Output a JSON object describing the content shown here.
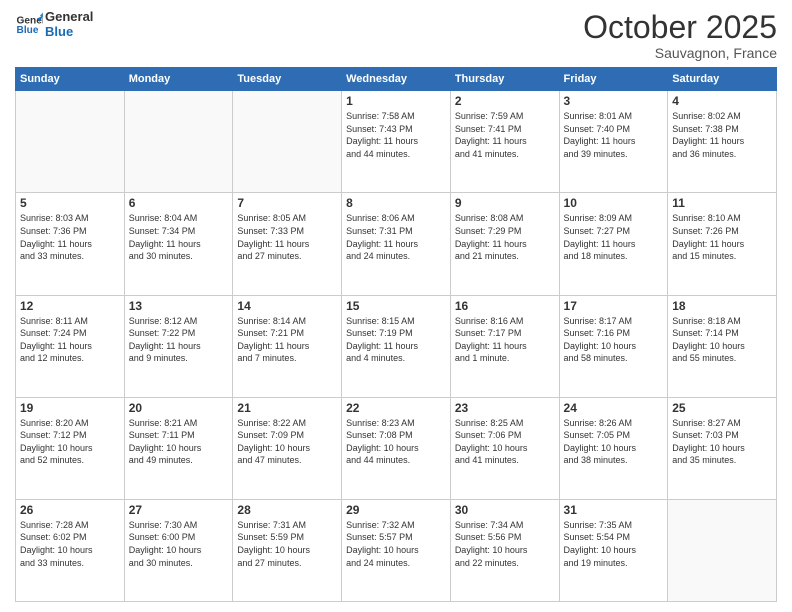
{
  "header": {
    "logo_line1": "General",
    "logo_line2": "Blue",
    "month": "October 2025",
    "location": "Sauvagnon, France"
  },
  "weekdays": [
    "Sunday",
    "Monday",
    "Tuesday",
    "Wednesday",
    "Thursday",
    "Friday",
    "Saturday"
  ],
  "weeks": [
    [
      {
        "day": "",
        "info": ""
      },
      {
        "day": "",
        "info": ""
      },
      {
        "day": "",
        "info": ""
      },
      {
        "day": "1",
        "info": "Sunrise: 7:58 AM\nSunset: 7:43 PM\nDaylight: 11 hours\nand 44 minutes."
      },
      {
        "day": "2",
        "info": "Sunrise: 7:59 AM\nSunset: 7:41 PM\nDaylight: 11 hours\nand 41 minutes."
      },
      {
        "day": "3",
        "info": "Sunrise: 8:01 AM\nSunset: 7:40 PM\nDaylight: 11 hours\nand 39 minutes."
      },
      {
        "day": "4",
        "info": "Sunrise: 8:02 AM\nSunset: 7:38 PM\nDaylight: 11 hours\nand 36 minutes."
      }
    ],
    [
      {
        "day": "5",
        "info": "Sunrise: 8:03 AM\nSunset: 7:36 PM\nDaylight: 11 hours\nand 33 minutes."
      },
      {
        "day": "6",
        "info": "Sunrise: 8:04 AM\nSunset: 7:34 PM\nDaylight: 11 hours\nand 30 minutes."
      },
      {
        "day": "7",
        "info": "Sunrise: 8:05 AM\nSunset: 7:33 PM\nDaylight: 11 hours\nand 27 minutes."
      },
      {
        "day": "8",
        "info": "Sunrise: 8:06 AM\nSunset: 7:31 PM\nDaylight: 11 hours\nand 24 minutes."
      },
      {
        "day": "9",
        "info": "Sunrise: 8:08 AM\nSunset: 7:29 PM\nDaylight: 11 hours\nand 21 minutes."
      },
      {
        "day": "10",
        "info": "Sunrise: 8:09 AM\nSunset: 7:27 PM\nDaylight: 11 hours\nand 18 minutes."
      },
      {
        "day": "11",
        "info": "Sunrise: 8:10 AM\nSunset: 7:26 PM\nDaylight: 11 hours\nand 15 minutes."
      }
    ],
    [
      {
        "day": "12",
        "info": "Sunrise: 8:11 AM\nSunset: 7:24 PM\nDaylight: 11 hours\nand 12 minutes."
      },
      {
        "day": "13",
        "info": "Sunrise: 8:12 AM\nSunset: 7:22 PM\nDaylight: 11 hours\nand 9 minutes."
      },
      {
        "day": "14",
        "info": "Sunrise: 8:14 AM\nSunset: 7:21 PM\nDaylight: 11 hours\nand 7 minutes."
      },
      {
        "day": "15",
        "info": "Sunrise: 8:15 AM\nSunset: 7:19 PM\nDaylight: 11 hours\nand 4 minutes."
      },
      {
        "day": "16",
        "info": "Sunrise: 8:16 AM\nSunset: 7:17 PM\nDaylight: 11 hours\nand 1 minute."
      },
      {
        "day": "17",
        "info": "Sunrise: 8:17 AM\nSunset: 7:16 PM\nDaylight: 10 hours\nand 58 minutes."
      },
      {
        "day": "18",
        "info": "Sunrise: 8:18 AM\nSunset: 7:14 PM\nDaylight: 10 hours\nand 55 minutes."
      }
    ],
    [
      {
        "day": "19",
        "info": "Sunrise: 8:20 AM\nSunset: 7:12 PM\nDaylight: 10 hours\nand 52 minutes."
      },
      {
        "day": "20",
        "info": "Sunrise: 8:21 AM\nSunset: 7:11 PM\nDaylight: 10 hours\nand 49 minutes."
      },
      {
        "day": "21",
        "info": "Sunrise: 8:22 AM\nSunset: 7:09 PM\nDaylight: 10 hours\nand 47 minutes."
      },
      {
        "day": "22",
        "info": "Sunrise: 8:23 AM\nSunset: 7:08 PM\nDaylight: 10 hours\nand 44 minutes."
      },
      {
        "day": "23",
        "info": "Sunrise: 8:25 AM\nSunset: 7:06 PM\nDaylight: 10 hours\nand 41 minutes."
      },
      {
        "day": "24",
        "info": "Sunrise: 8:26 AM\nSunset: 7:05 PM\nDaylight: 10 hours\nand 38 minutes."
      },
      {
        "day": "25",
        "info": "Sunrise: 8:27 AM\nSunset: 7:03 PM\nDaylight: 10 hours\nand 35 minutes."
      }
    ],
    [
      {
        "day": "26",
        "info": "Sunrise: 7:28 AM\nSunset: 6:02 PM\nDaylight: 10 hours\nand 33 minutes."
      },
      {
        "day": "27",
        "info": "Sunrise: 7:30 AM\nSunset: 6:00 PM\nDaylight: 10 hours\nand 30 minutes."
      },
      {
        "day": "28",
        "info": "Sunrise: 7:31 AM\nSunset: 5:59 PM\nDaylight: 10 hours\nand 27 minutes."
      },
      {
        "day": "29",
        "info": "Sunrise: 7:32 AM\nSunset: 5:57 PM\nDaylight: 10 hours\nand 24 minutes."
      },
      {
        "day": "30",
        "info": "Sunrise: 7:34 AM\nSunset: 5:56 PM\nDaylight: 10 hours\nand 22 minutes."
      },
      {
        "day": "31",
        "info": "Sunrise: 7:35 AM\nSunset: 5:54 PM\nDaylight: 10 hours\nand 19 minutes."
      },
      {
        "day": "",
        "info": ""
      }
    ]
  ]
}
